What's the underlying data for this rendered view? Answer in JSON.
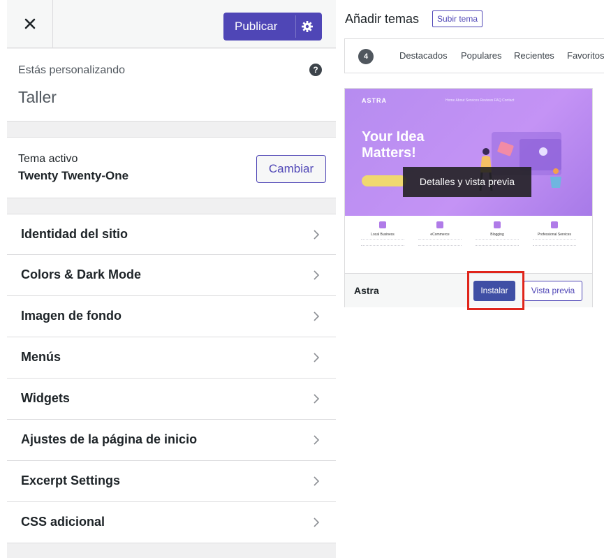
{
  "customizer": {
    "publish_label": "Publicar",
    "customizing_label": "Estás personalizando",
    "site_name": "Taller",
    "active_theme_label": "Tema activo",
    "active_theme_name": "Twenty Twenty-One",
    "change_label": "Cambiar",
    "sections": [
      {
        "label": "Identidad del sitio"
      },
      {
        "label": "Colors & Dark Mode"
      },
      {
        "label": "Imagen de fondo"
      },
      {
        "label": "Menús"
      },
      {
        "label": "Widgets"
      },
      {
        "label": "Ajustes de la página de inicio"
      },
      {
        "label": "Excerpt Settings"
      },
      {
        "label": "CSS adicional"
      }
    ]
  },
  "themes": {
    "title": "Añadir temas",
    "upload_label": "Subir tema",
    "count": "4",
    "tabs": [
      "Destacados",
      "Populares",
      "Recientes",
      "Favoritos"
    ],
    "card": {
      "logo": "ASTRA",
      "nav": "Home   About   Services   Reviews   FAQ   Contact",
      "hero_title": "Your Idea Matters!",
      "overlay_label": "Detalles y vista previa",
      "features": [
        "Local Business",
        "eCommerce",
        "Blogging",
        "Professional Services"
      ],
      "name": "Astra",
      "install_label": "Instalar",
      "preview_label": "Vista previa"
    }
  },
  "colors": {
    "accent": "#4f46b6",
    "hero": "#c493f5",
    "highlight": "#e0251b"
  }
}
